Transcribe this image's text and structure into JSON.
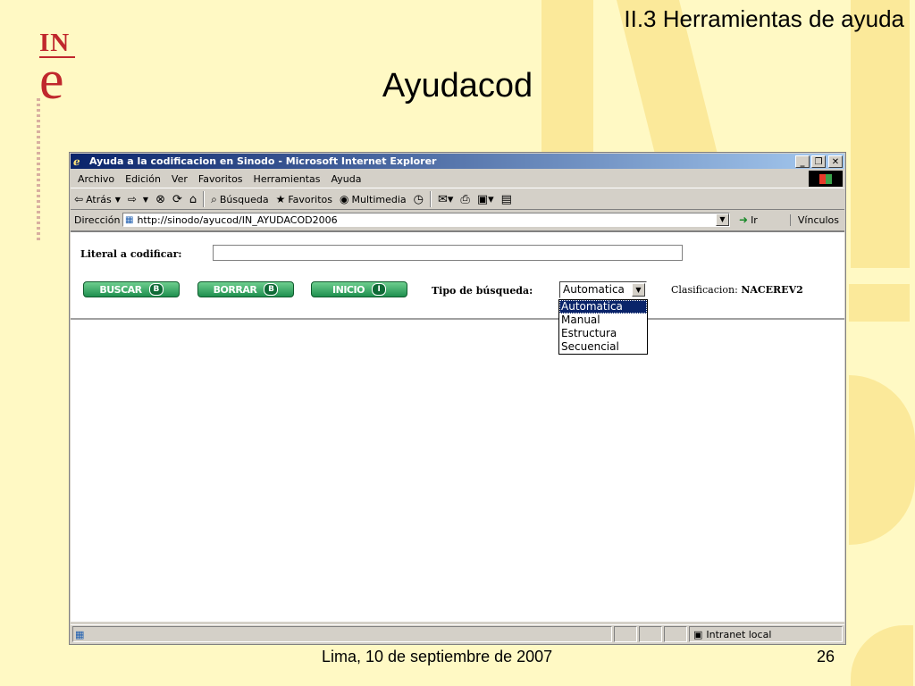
{
  "slide": {
    "header": "II.3 Herramientas de ayuda",
    "title": "Ayudacod",
    "footer_date": "Lima, 10 de septiembre de 2007",
    "footer_page": "26",
    "logo_text": "INe"
  },
  "colors": {
    "slide_background": "#fff9c4",
    "watermark": "#fbe99a",
    "logo": "#c0282d",
    "titlebar_start": "#0a246a",
    "button_green": "#1f8f4f"
  },
  "window": {
    "title": "Ayuda a la codificacion en Sinodo - Microsoft Internet Explorer",
    "controls": [
      "minimize-icon",
      "restore-icon",
      "close-icon"
    ]
  },
  "menubar": [
    "Archivo",
    "Edición",
    "Ver",
    "Favoritos",
    "Herramientas",
    "Ayuda"
  ],
  "toolbar": {
    "back": "Atrás",
    "search": "Búsqueda",
    "favorites": "Favoritos",
    "media": "Multimedia"
  },
  "addressbar": {
    "label": "Dirección",
    "url": "http://sinodo/ayucod/IN_AYUDACOD2006",
    "go": "Ir",
    "links": "Vínculos"
  },
  "form": {
    "literal_label": "Literal a codificar:",
    "literal_value": "",
    "buttons": [
      {
        "label": "BUSCAR",
        "key": "B"
      },
      {
        "label": "BORRAR",
        "key": "B"
      },
      {
        "label": "INICIO",
        "key": "I"
      }
    ],
    "tipo_label": "Tipo de búsqueda:",
    "tipo_selected": "Automatica",
    "tipo_options": [
      "Automatica",
      "Manual",
      "Estructura",
      "Secuencial"
    ],
    "clasificacion_label": "Clasificacion:",
    "clasificacion_value": "NACEREV2"
  },
  "statusbar": {
    "zone": "Intranet local"
  }
}
